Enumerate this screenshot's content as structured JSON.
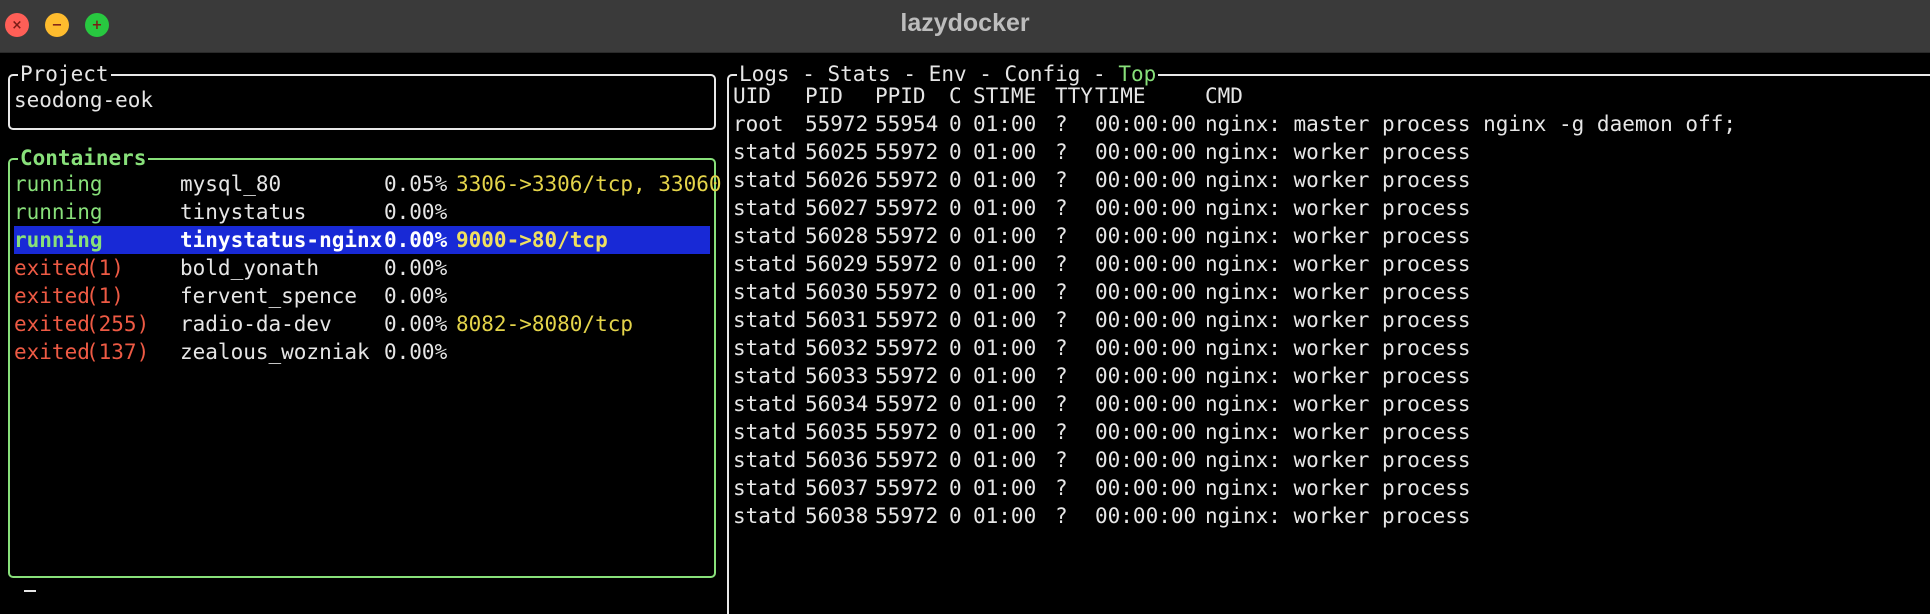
{
  "window": {
    "title": "lazydocker"
  },
  "project": {
    "title": "Project",
    "name": "seodong-eok"
  },
  "containers": {
    "title": "Containers",
    "rows": [
      {
        "status": "running",
        "code": "",
        "name": "mysql_80",
        "cpu": "0.05%",
        "ports": "3306->3306/tcp, 33060"
      },
      {
        "status": "running",
        "code": "",
        "name": "tinystatus",
        "cpu": "0.00%",
        "ports": ""
      },
      {
        "status": "running",
        "code": "",
        "name": "tinystatus-nginx",
        "cpu": "0.00%",
        "ports": "9000->80/tcp"
      },
      {
        "status": "exited",
        "code": "(1)",
        "name": "bold_yonath",
        "cpu": "0.00%",
        "ports": ""
      },
      {
        "status": "exited",
        "code": "(1)",
        "name": "fervent_spence",
        "cpu": "0.00%",
        "ports": ""
      },
      {
        "status": "exited",
        "code": "(255)",
        "name": "radio-da-dev",
        "cpu": "0.00%",
        "ports": "8082->8080/tcp"
      },
      {
        "status": "exited",
        "code": "(137)",
        "name": "zealous_wozniak",
        "cpu": "0.00%",
        "ports": ""
      }
    ],
    "selected_index": 2
  },
  "main": {
    "tabs": [
      "Logs",
      "Stats",
      "Env",
      "Config",
      "Top"
    ],
    "separator": " - ",
    "active_tab": "Top",
    "top": {
      "headers": [
        "UID",
        "PID",
        "PPID",
        "C",
        "STIME",
        "TTY",
        "TIME",
        "CMD"
      ],
      "rows": [
        [
          "root",
          "55972",
          "55954",
          "0",
          "01:00",
          "?",
          "00:00:00",
          "nginx: master process nginx -g daemon off;"
        ],
        [
          "statd",
          "56025",
          "55972",
          "0",
          "01:00",
          "?",
          "00:00:00",
          "nginx: worker process"
        ],
        [
          "statd",
          "56026",
          "55972",
          "0",
          "01:00",
          "?",
          "00:00:00",
          "nginx: worker process"
        ],
        [
          "statd",
          "56027",
          "55972",
          "0",
          "01:00",
          "?",
          "00:00:00",
          "nginx: worker process"
        ],
        [
          "statd",
          "56028",
          "55972",
          "0",
          "01:00",
          "?",
          "00:00:00",
          "nginx: worker process"
        ],
        [
          "statd",
          "56029",
          "55972",
          "0",
          "01:00",
          "?",
          "00:00:00",
          "nginx: worker process"
        ],
        [
          "statd",
          "56030",
          "55972",
          "0",
          "01:00",
          "?",
          "00:00:00",
          "nginx: worker process"
        ],
        [
          "statd",
          "56031",
          "55972",
          "0",
          "01:00",
          "?",
          "00:00:00",
          "nginx: worker process"
        ],
        [
          "statd",
          "56032",
          "55972",
          "0",
          "01:00",
          "?",
          "00:00:00",
          "nginx: worker process"
        ],
        [
          "statd",
          "56033",
          "55972",
          "0",
          "01:00",
          "?",
          "00:00:00",
          "nginx: worker process"
        ],
        [
          "statd",
          "56034",
          "55972",
          "0",
          "01:00",
          "?",
          "00:00:00",
          "nginx: worker process"
        ],
        [
          "statd",
          "56035",
          "55972",
          "0",
          "01:00",
          "?",
          "00:00:00",
          "nginx: worker process"
        ],
        [
          "statd",
          "56036",
          "55972",
          "0",
          "01:00",
          "?",
          "00:00:00",
          "nginx: worker process"
        ],
        [
          "statd",
          "56037",
          "55972",
          "0",
          "01:00",
          "?",
          "00:00:00",
          "nginx: worker process"
        ],
        [
          "statd",
          "56038",
          "55972",
          "0",
          "01:00",
          "?",
          "00:00:00",
          "nginx: worker process"
        ]
      ]
    }
  },
  "colors": {
    "running": "#88e07a",
    "exited": "#ee5a44",
    "ports": "#e4d44a",
    "selection": "#1829d6",
    "active_tab": "#88e07a"
  }
}
